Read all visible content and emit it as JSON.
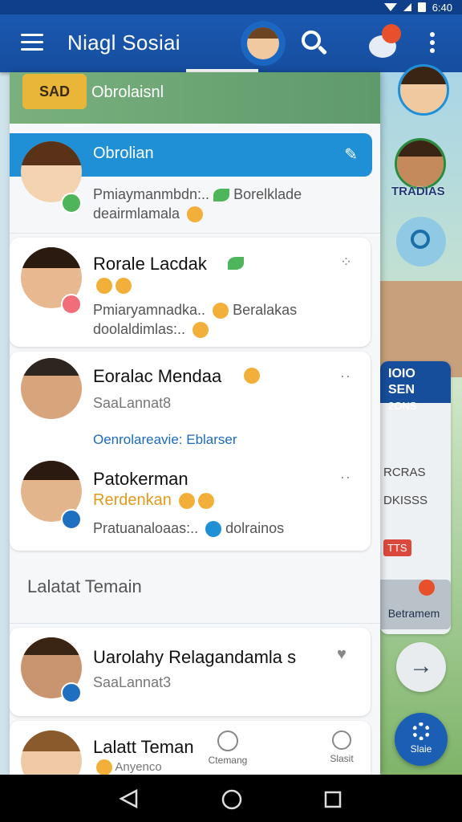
{
  "status_bar": {
    "time": "6:40"
  },
  "app_bar": {
    "title": "Niagl Sosiai"
  },
  "drawer": {
    "header_badge": "SAD",
    "header_title": "Obrolaisnl",
    "active_item": "Obrolian",
    "chats": [
      {
        "name": "",
        "preview_line1": "Pmiaymanmbdn:..",
        "preview_line1b": "Borelklade",
        "preview_line2": "deairmlamala"
      },
      {
        "name": "Rorale Lacdak",
        "preview_line1": "Pmiaryamnadka..",
        "preview_line1b": "Beralakas",
        "preview_line2": "doolaldimlas:.."
      },
      {
        "name": "Eoralac Mendaa",
        "subtitle": "SaaLannat8",
        "link": "Oenrolareavie: Eblarser"
      },
      {
        "name": "Patokerman",
        "subtitle": "Rerdenkan",
        "preview_line1": "Pratuanaloaas:..",
        "preview_line1b": "dolrainos"
      }
    ],
    "section_title": "Lalatat Temain",
    "friends": [
      {
        "name": "Uarolahy Relagandamla s",
        "subtitle": "SaaLannat3"
      },
      {
        "name": "Lalatt Teman",
        "subtitle": "Anyenco",
        "action1": "Ctemang",
        "action2": "Slasit"
      }
    ]
  },
  "scene": {
    "side_tag": "TRADIAS",
    "side_card_title": "IOIO SEN",
    "side_card_sub": "2ONS",
    "side_card_line1": "RCRAS",
    "side_card_line2": "DKISSS",
    "side_card_tag": "TTS",
    "friends_label": "Betramem",
    "settings_label": "Slaie",
    "next_arrow": "→"
  },
  "colors": {
    "primary": "#1a58b0",
    "accent": "#1f8fd6",
    "orange": "#e39a1c"
  }
}
